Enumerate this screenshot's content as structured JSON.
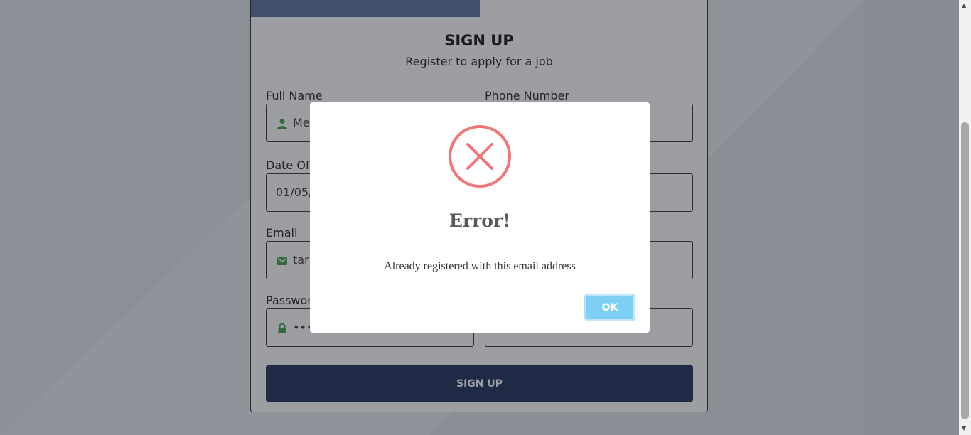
{
  "form": {
    "title": "SIGN UP",
    "subtitle": "Register to apply for a job",
    "full_name_label": "Full Name",
    "full_name_value": "Me",
    "phone_label": "Phone Number",
    "dob_label": "Date Of",
    "dob_value": "01/05/",
    "email_label": "Email",
    "email_value": "tar",
    "password_label": "Passwor",
    "password_value": "••••",
    "submit_label": "SIGN UP"
  },
  "dialog": {
    "title": "Error!",
    "message": "Already registered with this email address",
    "ok_label": "OK"
  },
  "colors": {
    "accent_green": "#3ea14a",
    "button_navy": "#1b2d58",
    "error_red": "#f27474",
    "ok_blue": "#7ecff4"
  },
  "icons": {
    "full_name": "user-icon",
    "email": "envelope-icon",
    "password": "lock-icon",
    "dialog": "error-x-circle-icon"
  }
}
